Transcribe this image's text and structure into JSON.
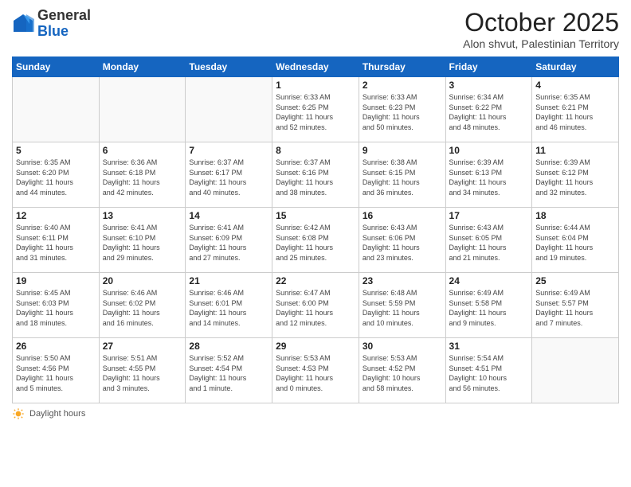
{
  "header": {
    "logo_general": "General",
    "logo_blue": "Blue",
    "month_title": "October 2025",
    "location": "Alon shvut, Palestinian Territory"
  },
  "weekdays": [
    "Sunday",
    "Monday",
    "Tuesday",
    "Wednesday",
    "Thursday",
    "Friday",
    "Saturday"
  ],
  "weeks": [
    [
      {
        "day": "",
        "info": ""
      },
      {
        "day": "",
        "info": ""
      },
      {
        "day": "",
        "info": ""
      },
      {
        "day": "1",
        "info": "Sunrise: 6:33 AM\nSunset: 6:25 PM\nDaylight: 11 hours\nand 52 minutes."
      },
      {
        "day": "2",
        "info": "Sunrise: 6:33 AM\nSunset: 6:23 PM\nDaylight: 11 hours\nand 50 minutes."
      },
      {
        "day": "3",
        "info": "Sunrise: 6:34 AM\nSunset: 6:22 PM\nDaylight: 11 hours\nand 48 minutes."
      },
      {
        "day": "4",
        "info": "Sunrise: 6:35 AM\nSunset: 6:21 PM\nDaylight: 11 hours\nand 46 minutes."
      }
    ],
    [
      {
        "day": "5",
        "info": "Sunrise: 6:35 AM\nSunset: 6:20 PM\nDaylight: 11 hours\nand 44 minutes."
      },
      {
        "day": "6",
        "info": "Sunrise: 6:36 AM\nSunset: 6:18 PM\nDaylight: 11 hours\nand 42 minutes."
      },
      {
        "day": "7",
        "info": "Sunrise: 6:37 AM\nSunset: 6:17 PM\nDaylight: 11 hours\nand 40 minutes."
      },
      {
        "day": "8",
        "info": "Sunrise: 6:37 AM\nSunset: 6:16 PM\nDaylight: 11 hours\nand 38 minutes."
      },
      {
        "day": "9",
        "info": "Sunrise: 6:38 AM\nSunset: 6:15 PM\nDaylight: 11 hours\nand 36 minutes."
      },
      {
        "day": "10",
        "info": "Sunrise: 6:39 AM\nSunset: 6:13 PM\nDaylight: 11 hours\nand 34 minutes."
      },
      {
        "day": "11",
        "info": "Sunrise: 6:39 AM\nSunset: 6:12 PM\nDaylight: 11 hours\nand 32 minutes."
      }
    ],
    [
      {
        "day": "12",
        "info": "Sunrise: 6:40 AM\nSunset: 6:11 PM\nDaylight: 11 hours\nand 31 minutes."
      },
      {
        "day": "13",
        "info": "Sunrise: 6:41 AM\nSunset: 6:10 PM\nDaylight: 11 hours\nand 29 minutes."
      },
      {
        "day": "14",
        "info": "Sunrise: 6:41 AM\nSunset: 6:09 PM\nDaylight: 11 hours\nand 27 minutes."
      },
      {
        "day": "15",
        "info": "Sunrise: 6:42 AM\nSunset: 6:08 PM\nDaylight: 11 hours\nand 25 minutes."
      },
      {
        "day": "16",
        "info": "Sunrise: 6:43 AM\nSunset: 6:06 PM\nDaylight: 11 hours\nand 23 minutes."
      },
      {
        "day": "17",
        "info": "Sunrise: 6:43 AM\nSunset: 6:05 PM\nDaylight: 11 hours\nand 21 minutes."
      },
      {
        "day": "18",
        "info": "Sunrise: 6:44 AM\nSunset: 6:04 PM\nDaylight: 11 hours\nand 19 minutes."
      }
    ],
    [
      {
        "day": "19",
        "info": "Sunrise: 6:45 AM\nSunset: 6:03 PM\nDaylight: 11 hours\nand 18 minutes."
      },
      {
        "day": "20",
        "info": "Sunrise: 6:46 AM\nSunset: 6:02 PM\nDaylight: 11 hours\nand 16 minutes."
      },
      {
        "day": "21",
        "info": "Sunrise: 6:46 AM\nSunset: 6:01 PM\nDaylight: 11 hours\nand 14 minutes."
      },
      {
        "day": "22",
        "info": "Sunrise: 6:47 AM\nSunset: 6:00 PM\nDaylight: 11 hours\nand 12 minutes."
      },
      {
        "day": "23",
        "info": "Sunrise: 6:48 AM\nSunset: 5:59 PM\nDaylight: 11 hours\nand 10 minutes."
      },
      {
        "day": "24",
        "info": "Sunrise: 6:49 AM\nSunset: 5:58 PM\nDaylight: 11 hours\nand 9 minutes."
      },
      {
        "day": "25",
        "info": "Sunrise: 6:49 AM\nSunset: 5:57 PM\nDaylight: 11 hours\nand 7 minutes."
      }
    ],
    [
      {
        "day": "26",
        "info": "Sunrise: 5:50 AM\nSunset: 4:56 PM\nDaylight: 11 hours\nand 5 minutes."
      },
      {
        "day": "27",
        "info": "Sunrise: 5:51 AM\nSunset: 4:55 PM\nDaylight: 11 hours\nand 3 minutes."
      },
      {
        "day": "28",
        "info": "Sunrise: 5:52 AM\nSunset: 4:54 PM\nDaylight: 11 hours\nand 1 minute."
      },
      {
        "day": "29",
        "info": "Sunrise: 5:53 AM\nSunset: 4:53 PM\nDaylight: 11 hours\nand 0 minutes."
      },
      {
        "day": "30",
        "info": "Sunrise: 5:53 AM\nSunset: 4:52 PM\nDaylight: 10 hours\nand 58 minutes."
      },
      {
        "day": "31",
        "info": "Sunrise: 5:54 AM\nSunset: 4:51 PM\nDaylight: 10 hours\nand 56 minutes."
      },
      {
        "day": "",
        "info": ""
      }
    ]
  ],
  "footer": {
    "daylight_label": "Daylight hours"
  }
}
